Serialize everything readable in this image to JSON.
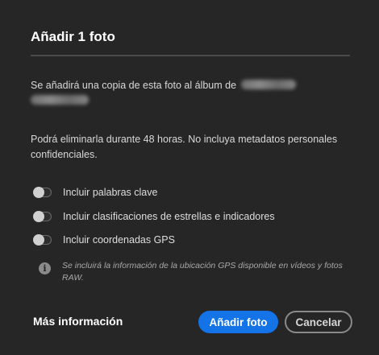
{
  "dialog": {
    "title": "Añadir 1 foto",
    "message1_prefix": "Se añadirá una copia de esta foto al álbum de",
    "message2": "Podrá eliminarla durante 48 horas. No incluya metadatos personales confidenciales.",
    "options": [
      {
        "label": "Incluir palabras clave",
        "enabled": false
      },
      {
        "label": "Incluir clasificaciones de estrellas e indicadores",
        "enabled": false
      },
      {
        "label": "Incluir coordenadas GPS",
        "enabled": false
      }
    ],
    "info_text": "Se incluirá la información de la ubicación GPS disponible en vídeos y fotos RAW.",
    "more_info": "Más información",
    "primary_button": "Añadir foto",
    "secondary_button": "Cancelar"
  },
  "colors": {
    "background": "#262626",
    "accent": "#1473e6",
    "text": "#e6e6e6"
  }
}
